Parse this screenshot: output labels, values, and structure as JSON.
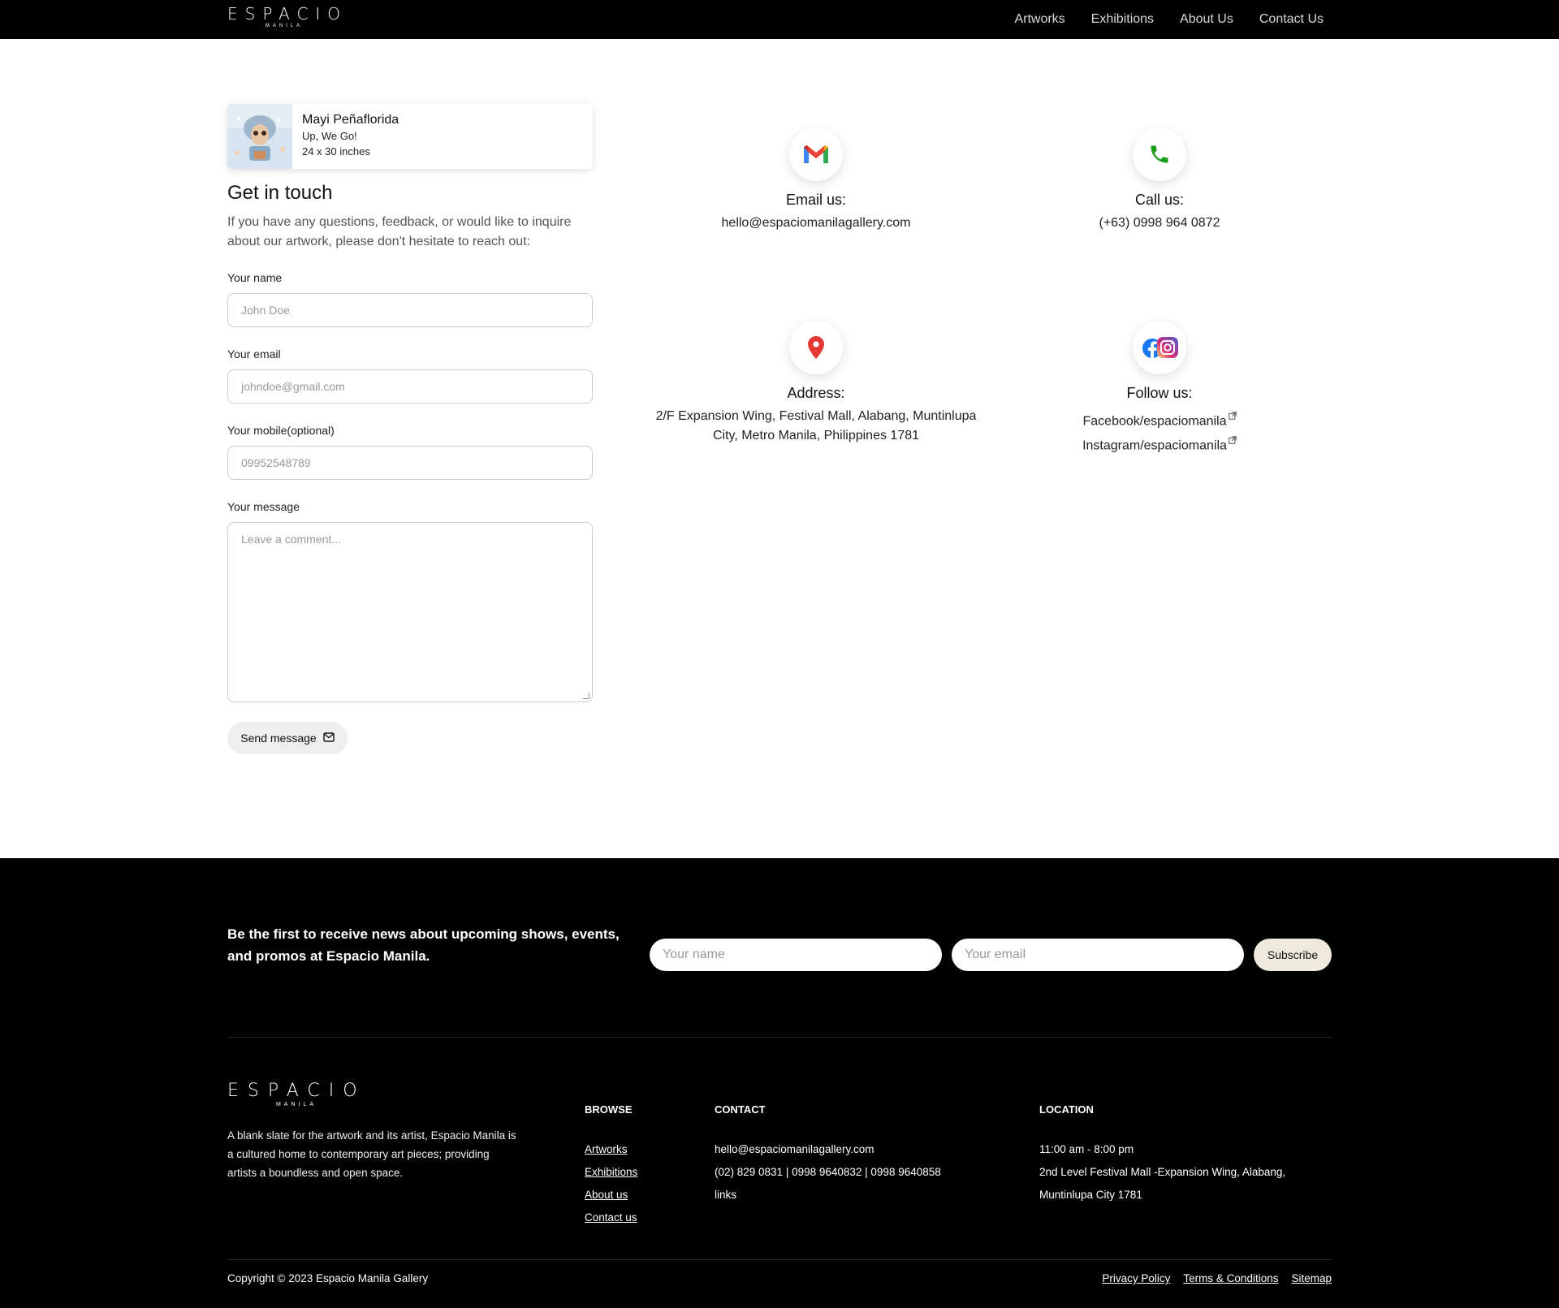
{
  "nav": {
    "logo_main": "ESPACIO",
    "logo_sub": "MANILA",
    "links": [
      "Artworks",
      "Exhibitions",
      "About Us",
      "Contact Us"
    ]
  },
  "artwork": {
    "artist": "Mayi Peñaflorida",
    "title": "Up, We Go!",
    "size": "24 x 30 inches"
  },
  "form": {
    "heading": "Get in touch",
    "intro": "If you have any questions, feedback, or would like to inquire about our artwork, please don't hesitate to reach out:",
    "name_label": "Your name",
    "name_placeholder": "John Doe",
    "email_label": "Your email",
    "email_placeholder": "johndoe@gmail.com",
    "mobile_label": "Your mobile(optional)",
    "mobile_placeholder": "09952548789",
    "message_label": "Your message",
    "message_placeholder": "Leave a comment...",
    "send_label": "Send message"
  },
  "contact": {
    "email_title": "Email us:",
    "email_value": "hello@espaciomanilagallery.com",
    "call_title": "Call us:",
    "call_value": "(+63) 0998 964 0872",
    "address_title": "Address:",
    "address_value": "2/F Expansion Wing, Festival Mall, Alabang, Muntinlupa City, Metro Manila, Philippines 1781",
    "follow_title": "Follow us:",
    "facebook": "Facebook/espaciomanila",
    "instagram": "Instagram/espaciomanila"
  },
  "colors": {
    "gmail_red": "#EA4335",
    "phone_green": "#1a9e1a",
    "pin_red": "#e53935",
    "facebook_blue": "#1877F2",
    "subscribe_bg": "#ede9dc"
  },
  "footer": {
    "newsletter": "Be the first to receive news about upcoming shows, events, and promos at Espacio Manila.",
    "name_placeholder": "Your name",
    "email_placeholder": "Your email",
    "subscribe": "Subscribe",
    "logo_main": "ESPACIO",
    "logo_sub": "MANILA",
    "about": "A blank slate for the artwork and its artist, Espacio Manila is a cultured home to contemporary art pieces; providing artists a boundless and open space.",
    "browse_head": "BROWSE",
    "browse_links": [
      "Artworks",
      "Exhibitions",
      "About us",
      "Contact us"
    ],
    "contact_head": "CONTACT",
    "contact_email": "hello@espaciomanilagallery.com",
    "contact_phones": "(02) 829 0831 | 0998 9640832 | 0998 9640858",
    "contact_links": "links",
    "location_head": "LOCATION",
    "hours": "11:00 am - 8:00 pm",
    "address_line1": "2nd Level Festival Mall -Expansion Wing, Alabang,",
    "address_line2": "Muntinlupa City 1781",
    "copyright": "Copyright © 2023 Espacio Manila Gallery",
    "legal_links": [
      "Privacy Policy",
      "Terms & Conditions",
      "Sitemap"
    ]
  }
}
